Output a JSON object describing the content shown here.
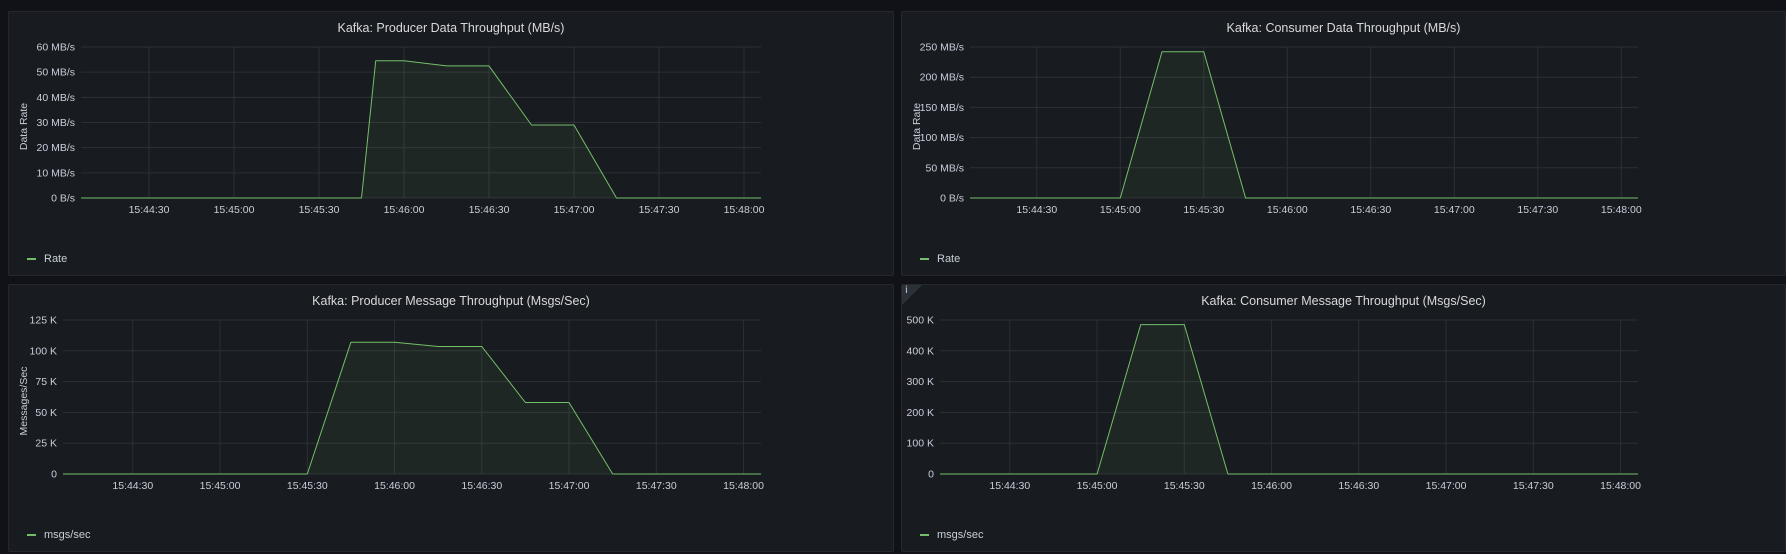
{
  "chart_data": [
    {
      "type": "area",
      "title": "Kafka: Producer Data Throughput (MB/s)",
      "ylabel": "Data Rate",
      "xlabel": "",
      "y_ticks": [
        "0 B/s",
        "10 MB/s",
        "20 MB/s",
        "30 MB/s",
        "40 MB/s",
        "50 MB/s",
        "60 MB/s"
      ],
      "ylim": [
        0,
        60
      ],
      "x_ticks": [
        "15:44:30",
        "15:45:00",
        "15:45:30",
        "15:46:00",
        "15:46:30",
        "15:47:00",
        "15:47:30",
        "15:48:00"
      ],
      "xlim": [
        "15:44:06",
        "15:48:06"
      ],
      "grid": true,
      "legend_position": "bottom-left",
      "series": [
        {
          "name": "Rate",
          "color": "#73bf69",
          "x": [
            "15:44:06",
            "15:45:45",
            "15:45:50",
            "15:46:00",
            "15:46:15",
            "15:46:30",
            "15:46:45",
            "15:47:00",
            "15:47:15",
            "15:48:06"
          ],
          "y": [
            0,
            0,
            54.5,
            54.5,
            52.5,
            52.5,
            29,
            29,
            0,
            0
          ]
        }
      ]
    },
    {
      "type": "area",
      "title": "Kafka: Consumer Data Throughput (MB/s)",
      "ylabel": "Data Rate",
      "xlabel": "",
      "y_ticks": [
        "0 B/s",
        "50 MB/s",
        "100 MB/s",
        "150 MB/s",
        "200 MB/s",
        "250 MB/s"
      ],
      "ylim": [
        0,
        250
      ],
      "x_ticks": [
        "15:44:30",
        "15:45:00",
        "15:45:30",
        "15:46:00",
        "15:46:30",
        "15:47:00",
        "15:47:30",
        "15:48:00"
      ],
      "xlim": [
        "15:44:06",
        "15:48:06"
      ],
      "grid": true,
      "legend_position": "bottom-left",
      "series": [
        {
          "name": "Rate",
          "color": "#73bf69",
          "x": [
            "15:44:06",
            "15:45:00",
            "15:45:15",
            "15:45:30",
            "15:45:45",
            "15:48:06"
          ],
          "y": [
            0,
            0,
            242,
            242,
            0,
            0
          ]
        }
      ]
    },
    {
      "type": "area",
      "title": "Kafka: Producer Message Throughput (Msgs/Sec)",
      "ylabel": "Messages/Sec",
      "xlabel": "",
      "y_ticks": [
        "0",
        "25 K",
        "50 K",
        "75 K",
        "100 K",
        "125 K"
      ],
      "ylim": [
        0,
        125
      ],
      "x_ticks": [
        "15:44:30",
        "15:45:00",
        "15:45:30",
        "15:46:00",
        "15:46:30",
        "15:47:00",
        "15:47:30",
        "15:48:00"
      ],
      "xlim": [
        "15:44:06",
        "15:48:06"
      ],
      "grid": true,
      "legend_position": "bottom-left",
      "series": [
        {
          "name": "msgs/sec",
          "color": "#73bf69",
          "x": [
            "15:44:06",
            "15:45:30",
            "15:45:45",
            "15:46:00",
            "15:46:15",
            "15:46:30",
            "15:46:45",
            "15:47:00",
            "15:47:15",
            "15:48:06"
          ],
          "y": [
            0,
            0,
            107,
            107,
            103.5,
            103.5,
            58,
            58,
            0,
            0
          ]
        }
      ]
    },
    {
      "type": "area",
      "title": "Kafka: Consumer Message Throughput (Msgs/Sec)",
      "ylabel": "",
      "xlabel": "",
      "y_ticks": [
        "0",
        "100 K",
        "200 K",
        "300 K",
        "400 K",
        "500 K"
      ],
      "ylim": [
        0,
        500
      ],
      "x_ticks": [
        "15:44:30",
        "15:45:00",
        "15:45:30",
        "15:46:00",
        "15:46:30",
        "15:47:00",
        "15:47:30",
        "15:48:00"
      ],
      "xlim": [
        "15:44:06",
        "15:48:06"
      ],
      "grid": true,
      "legend_position": "bottom-left",
      "series": [
        {
          "name": "msgs/sec",
          "color": "#73bf69",
          "x": [
            "15:44:06",
            "15:45:00",
            "15:45:15",
            "15:45:30",
            "15:45:45",
            "15:48:06"
          ],
          "y": [
            0,
            0,
            485,
            485,
            0,
            0
          ]
        }
      ]
    }
  ],
  "panels": [
    {
      "title": "Kafka: Producer Data Throughput (MB/s)",
      "legend": "Rate"
    },
    {
      "title": "Kafka: Consumer Data Throughput (MB/s)",
      "legend": "Rate"
    },
    {
      "title": "Kafka: Producer Message Throughput (Msgs/Sec)",
      "legend": "msgs/sec"
    },
    {
      "title": "Kafka: Consumer Message Throughput (Msgs/Sec)",
      "legend": "msgs/sec",
      "info_icon": "info-icon"
    }
  ],
  "colors": {
    "background": "#111217",
    "panel": "#181b1f",
    "grid": "#2c3035",
    "series": "#73bf69",
    "text": "#ccccdc"
  }
}
